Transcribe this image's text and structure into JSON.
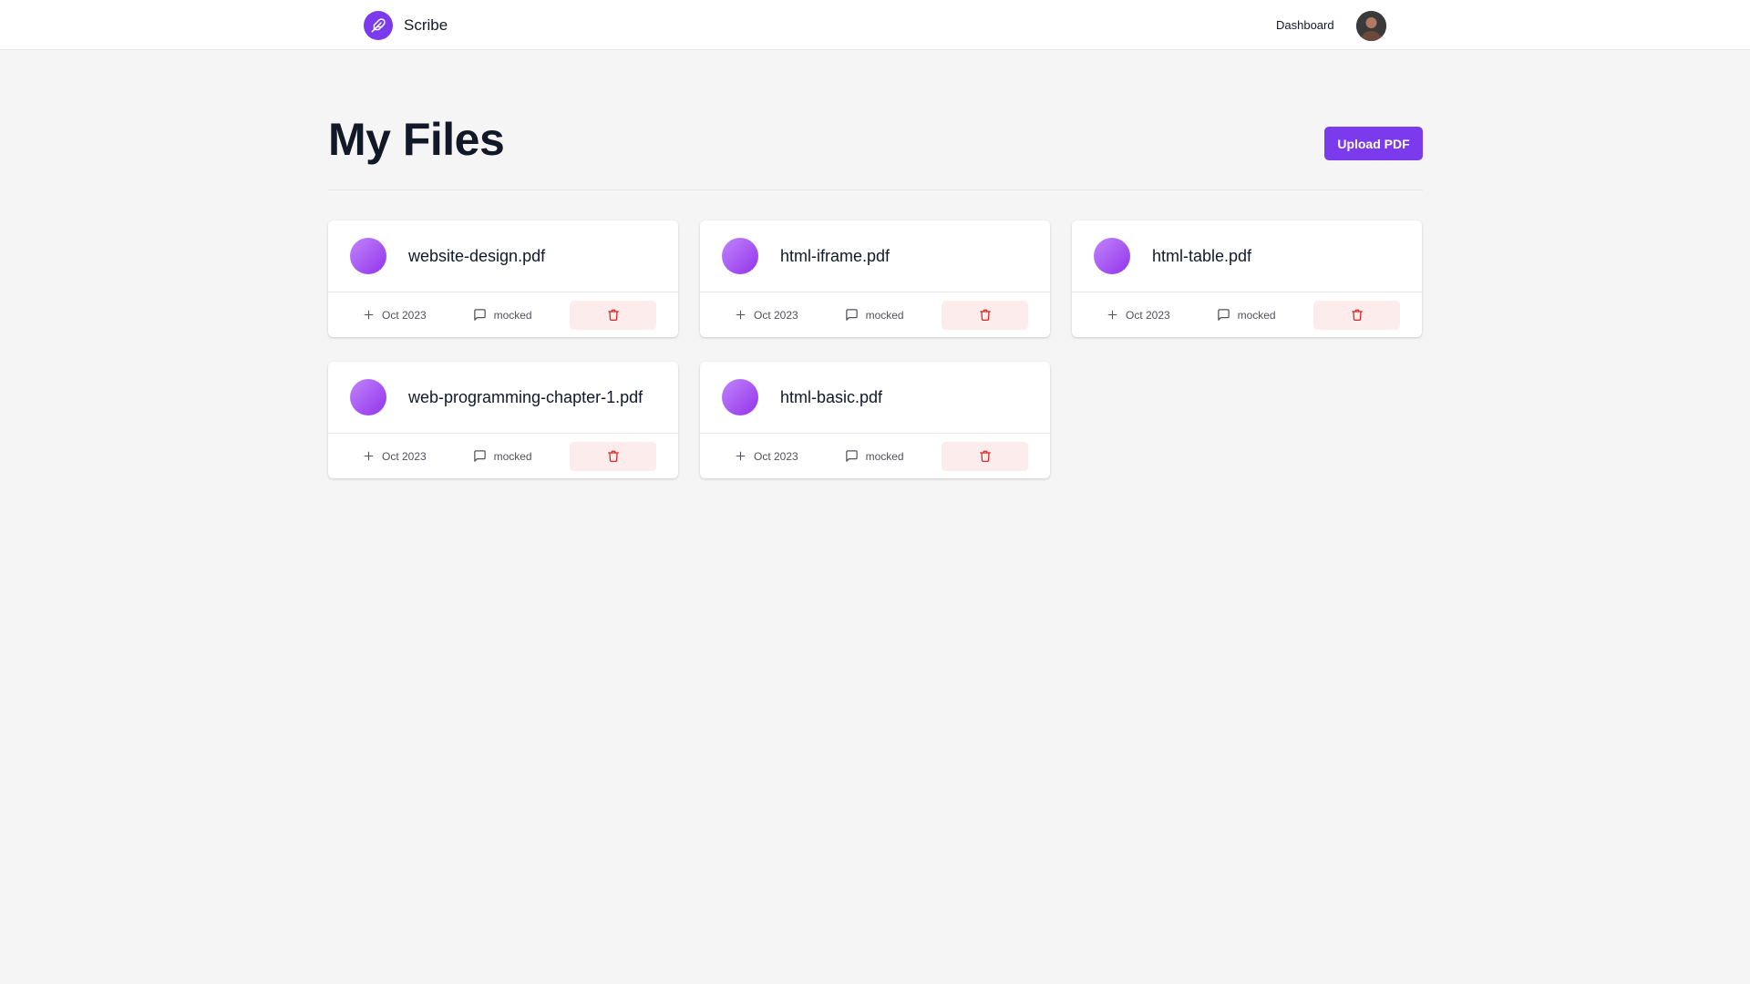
{
  "app": {
    "name": "Scribe"
  },
  "nav": {
    "dashboard_label": "Dashboard"
  },
  "page": {
    "title": "My Files",
    "upload_label": "Upload PDF"
  },
  "colors": {
    "accent": "#7c3aed",
    "danger": "#dc2626",
    "danger_bg": "#fdecec"
  },
  "files": [
    {
      "name": "website-design.pdf",
      "date": "Oct 2023",
      "messages": "mocked"
    },
    {
      "name": "html-iframe.pdf",
      "date": "Oct 2023",
      "messages": "mocked"
    },
    {
      "name": "html-table.pdf",
      "date": "Oct 2023",
      "messages": "mocked"
    },
    {
      "name": "web-programming-chapter-1.pdf",
      "date": "Oct 2023",
      "messages": "mocked"
    },
    {
      "name": "html-basic.pdf",
      "date": "Oct 2023",
      "messages": "mocked"
    }
  ],
  "icons": {
    "logo": "quill-icon",
    "date": "plus-icon",
    "messages": "message-square-icon",
    "delete": "trash-icon"
  }
}
